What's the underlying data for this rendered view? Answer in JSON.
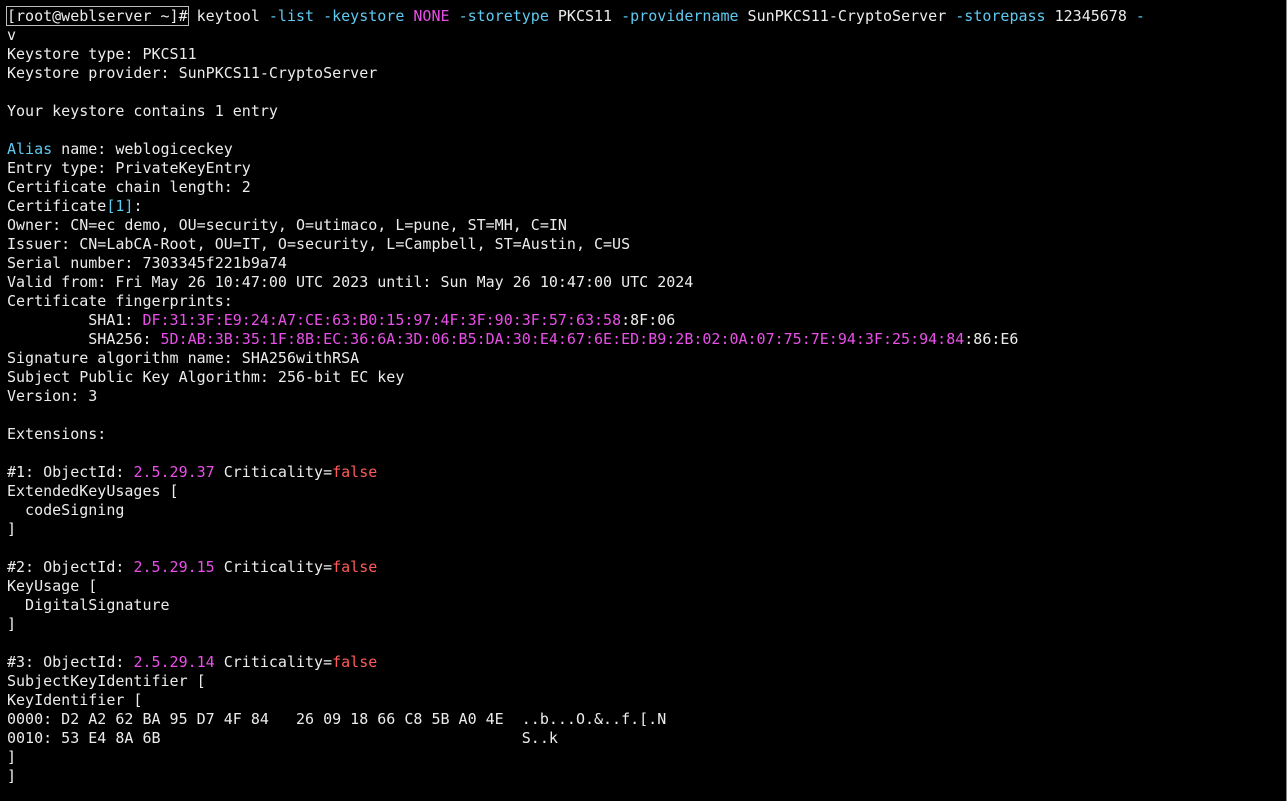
{
  "colors": {
    "background": "#000000",
    "text": "#ececec",
    "option": "#5fc9f0",
    "magenta": "#ea4fe9",
    "boolean": "#ff5a5a"
  },
  "lines": [
    [
      {
        "t": "[root@weblserver ~]# keytool ",
        "c": "text"
      },
      {
        "t": "-list",
        "c": "cyan"
      },
      {
        "t": " ",
        "c": "text"
      },
      {
        "t": "-keystore",
        "c": "cyan"
      },
      {
        "t": " ",
        "c": "text"
      },
      {
        "t": "NONE",
        "c": "mag"
      },
      {
        "t": " ",
        "c": "text"
      },
      {
        "t": "-storetype",
        "c": "cyan"
      },
      {
        "t": " PKCS11 ",
        "c": "text"
      },
      {
        "t": "-providername",
        "c": "cyan"
      },
      {
        "t": " SunPKCS11-CryptoServer ",
        "c": "text"
      },
      {
        "t": "-storepass",
        "c": "cyan"
      },
      {
        "t": " 12345678 ",
        "c": "text"
      },
      {
        "t": "-",
        "c": "cyan"
      }
    ],
    [
      {
        "t": "v",
        "c": "text"
      }
    ],
    [
      {
        "t": "Keystore type: PKCS11",
        "c": "text"
      }
    ],
    [
      {
        "t": "Keystore provider: SunPKCS11-CryptoServer",
        "c": "text"
      }
    ],
    [],
    [
      {
        "t": "Your keystore contains 1 entry",
        "c": "text"
      }
    ],
    [],
    [
      {
        "t": "Alias",
        "c": "cyan"
      },
      {
        "t": " name: weblogiceckey",
        "c": "text"
      }
    ],
    [
      {
        "t": "Entry type: PrivateKeyEntry",
        "c": "text"
      }
    ],
    [
      {
        "t": "Certificate chain length: 2",
        "c": "text"
      }
    ],
    [
      {
        "t": "Certificate",
        "c": "text"
      },
      {
        "t": "[1]",
        "c": "cyan"
      },
      {
        "t": ":",
        "c": "text"
      }
    ],
    [
      {
        "t": "Owner: CN=ec demo, OU=security, O=utimaco, L=pune, ST=MH, C=IN",
        "c": "text"
      }
    ],
    [
      {
        "t": "Issuer: CN=LabCA-Root, OU=IT, O=security, L=Campbell, ST=Austin, C=US",
        "c": "text"
      }
    ],
    [
      {
        "t": "Serial number: 7303345f221b9a74",
        "c": "text"
      }
    ],
    [
      {
        "t": "Valid from: Fri May 26 10:47:00 UTC 2023 until: Sun May 26 10:47:00 UTC 2024",
        "c": "text"
      }
    ],
    [
      {
        "t": "Certificate fingerprints:",
        "c": "text"
      }
    ],
    [
      {
        "t": "         SHA1: ",
        "c": "text"
      },
      {
        "t": "DF:31:3F:E9:24:A7:CE:63:B0:15:97:4F:3F:90:3F:57:63:58",
        "c": "mag"
      },
      {
        "t": ":8F:06",
        "c": "text"
      }
    ],
    [
      {
        "t": "         SHA256: ",
        "c": "text"
      },
      {
        "t": "5D:AB:3B:35:1F:8B:EC:36:6A:3D:06:B5:DA:30:E4:67:6E:ED:B9:2B:02:0A:07:75:7E:94:3F:25:94:84",
        "c": "mag"
      },
      {
        "t": ":86:E6",
        "c": "text"
      }
    ],
    [
      {
        "t": "Signature algorithm name: SHA256withRSA",
        "c": "text"
      }
    ],
    [
      {
        "t": "Subject Public Key Algorithm: 256-bit EC key",
        "c": "text"
      }
    ],
    [
      {
        "t": "Version: 3",
        "c": "text"
      }
    ],
    [],
    [
      {
        "t": "Extensions:",
        "c": "text"
      }
    ],
    [],
    [
      {
        "t": "#1: ObjectId: ",
        "c": "text"
      },
      {
        "t": "2.5.29.37",
        "c": "mag"
      },
      {
        "t": " Criticality=",
        "c": "text"
      },
      {
        "t": "false",
        "c": "red"
      }
    ],
    [
      {
        "t": "ExtendedKeyUsages [",
        "c": "text"
      }
    ],
    [
      {
        "t": "  codeSigning",
        "c": "text"
      }
    ],
    [
      {
        "t": "]",
        "c": "text"
      }
    ],
    [],
    [
      {
        "t": "#2: ObjectId: ",
        "c": "text"
      },
      {
        "t": "2.5.29.15",
        "c": "mag"
      },
      {
        "t": " Criticality=",
        "c": "text"
      },
      {
        "t": "false",
        "c": "red"
      }
    ],
    [
      {
        "t": "KeyUsage [",
        "c": "text"
      }
    ],
    [
      {
        "t": "  DigitalSignature",
        "c": "text"
      }
    ],
    [
      {
        "t": "]",
        "c": "text"
      }
    ],
    [],
    [
      {
        "t": "#3: ObjectId: ",
        "c": "text"
      },
      {
        "t": "2.5.29.14",
        "c": "mag"
      },
      {
        "t": " Criticality=",
        "c": "text"
      },
      {
        "t": "false",
        "c": "red"
      }
    ],
    [
      {
        "t": "SubjectKeyIdentifier [",
        "c": "text"
      }
    ],
    [
      {
        "t": "KeyIdentifier [",
        "c": "text"
      }
    ],
    [
      {
        "t": "0000: D2 A2 62 BA 95 D7 4F 84   26 09 18 66 C8 5B A0 4E  ..b...O.&..f.[.N",
        "c": "text"
      }
    ],
    [
      {
        "t": "0010: 53 E4 8A 6B                                        S..k",
        "c": "text"
      }
    ],
    [
      {
        "t": "]",
        "c": "text"
      }
    ],
    [
      {
        "t": "]",
        "c": "text"
      }
    ]
  ]
}
